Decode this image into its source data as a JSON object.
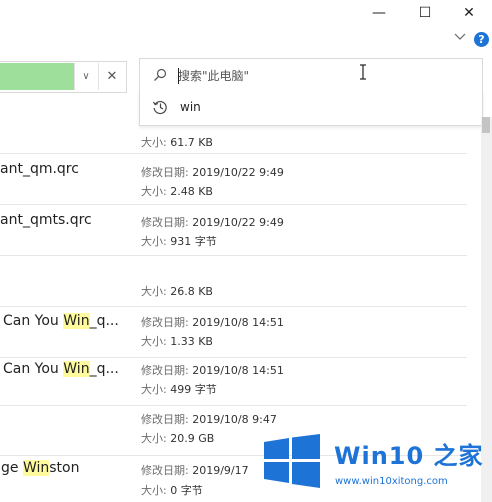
{
  "window_controls": {
    "minimize": "—",
    "maximize": "☐",
    "close": "✕"
  },
  "ribbon": {
    "help": "?"
  },
  "address_bar": {
    "dropdown_glyph": "∨",
    "clear_glyph": "✕"
  },
  "search": {
    "placeholder": "搜索\"此电脑\"",
    "suggestion": "win"
  },
  "rows": [
    {
      "size_label": "大小:",
      "size": "61.7 KB"
    },
    {
      "name": "ant_qm.qrc",
      "date_label": "修改日期:",
      "date": "2019/10/22 9:49",
      "size_label": "大小:",
      "size": "2.48 KB"
    },
    {
      "name": "ant_qmts.qrc",
      "date_label": "修改日期:",
      "date": "2019/10/22 9:49",
      "size_label": "大小:",
      "size": "931 字节"
    },
    {
      "size_label": "大小:",
      "size": "26.8 KB"
    },
    {
      "name_pre": "Can You ",
      "name_hl": "Win",
      "name_post": "_q...",
      "date_label": "修改日期:",
      "date": "2019/10/8 14:51",
      "size_label": "大小:",
      "size": "1.33 KB"
    },
    {
      "name_pre": "Can You ",
      "name_hl": "Win",
      "name_post": "_q...",
      "date_label": "修改日期:",
      "date": "2019/10/8 14:51",
      "size_label": "大小:",
      "size": "499 字节"
    },
    {
      "date_label": "修改日期:",
      "date": "2019/10/8 9:47",
      "size_label": "大小:",
      "size": "20.9 GB"
    },
    {
      "name_pre": "ge ",
      "name_hl": "Win",
      "name_post": "ston",
      "date_label": "修改日期:",
      "date": "2019/9/17",
      "size_label": "大小:",
      "size": "0 字节"
    }
  ],
  "watermark": {
    "title": "Win10 之家",
    "url": "www.win10xitong.com"
  },
  "colors": {
    "address_progress": "#9ddf9b",
    "highlight": "#fffb9d",
    "accent": "#1e73d7"
  }
}
